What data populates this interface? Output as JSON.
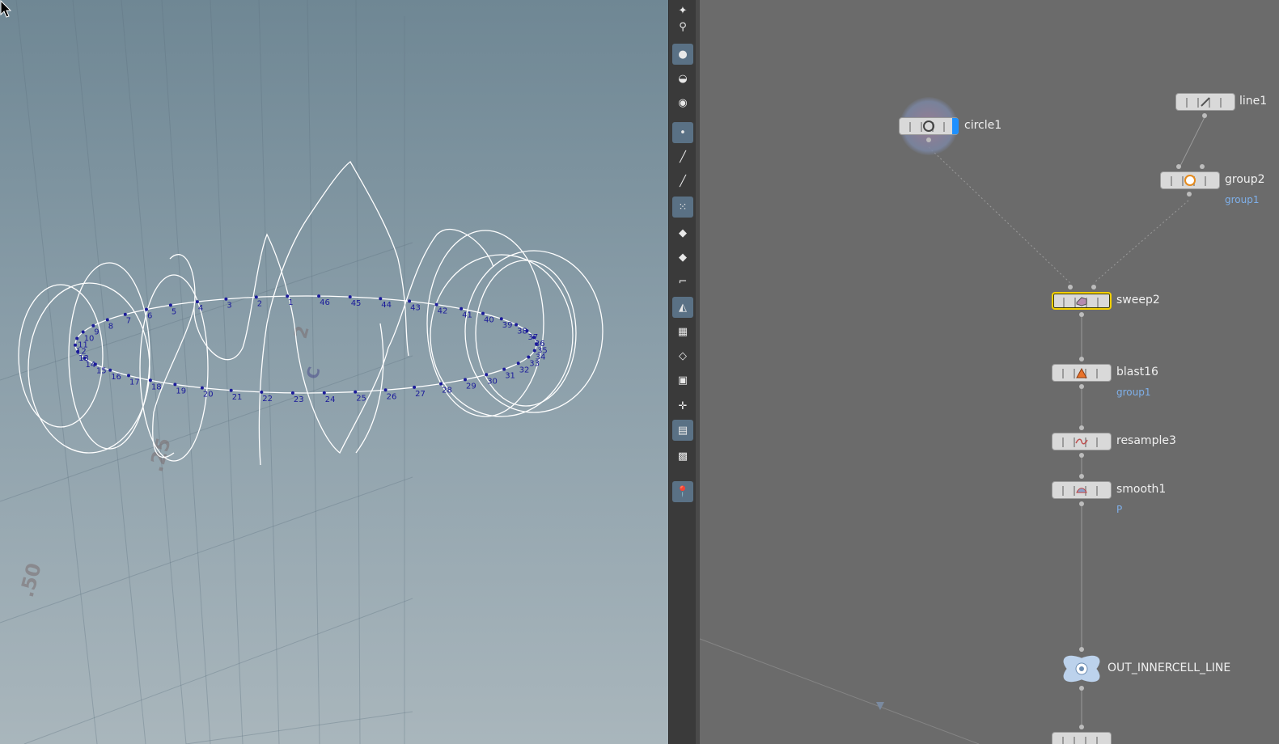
{
  "colors": {
    "viewport_top": "#6f8794",
    "viewport_bottom": "#a9b6bc",
    "network_bg": "#6b6b6b",
    "point_label": "#1a1a9a",
    "selected_outline": "#f4d000",
    "subtitle": "#7fb0ea"
  },
  "viewport": {
    "grid_labels": [
      ".25",
      ".50"
    ],
    "point_numbers": [
      "1",
      "2",
      "3",
      "4",
      "5",
      "6",
      "7",
      "8",
      "9",
      "10",
      "11",
      "12",
      "13",
      "14",
      "15",
      "16",
      "17",
      "18",
      "19",
      "20",
      "21",
      "22",
      "23",
      "24",
      "25",
      "26",
      "27",
      "28",
      "29",
      "30",
      "31",
      "32",
      "33",
      "34",
      "35",
      "36",
      "37",
      "38",
      "39",
      "40",
      "41",
      "42",
      "43",
      "44",
      "45",
      "46"
    ]
  },
  "toolbar": {
    "icons": [
      "light-icon",
      "spot-light-icon",
      "camera-lookthrough-icon",
      "display-options-icon",
      "view-camera-icon",
      "point-display-icon",
      "normal-display-icon",
      "brush-icon",
      "point-numbers-icon",
      "primitive-display-icon",
      "primitive-numbers-icon",
      "curve-icon",
      "polygon-display-icon",
      "uv-checker-icon",
      "template-icon",
      "guide-icon",
      "origin-icon",
      "background-icon",
      "frame-icon",
      "pin-icon"
    ]
  },
  "network": {
    "nodes": {
      "circle1": {
        "name": "circle1",
        "icon": "circle-icon"
      },
      "line1": {
        "name": "line1",
        "icon": "line-icon"
      },
      "group2": {
        "name": "group2",
        "sub": "group1",
        "icon": "group-icon"
      },
      "sweep2": {
        "name": "sweep2",
        "icon": "sweep-icon"
      },
      "blast16": {
        "name": "blast16",
        "sub": "group1",
        "icon": "blast-icon"
      },
      "resample3": {
        "name": "resample3",
        "icon": "resample-icon"
      },
      "smooth1": {
        "name": "smooth1",
        "sub": "P",
        "icon": "smooth-icon"
      },
      "out_innercell_line": {
        "name": "OUT_INNERCELL_LINE",
        "icon": "null-icon"
      }
    }
  }
}
